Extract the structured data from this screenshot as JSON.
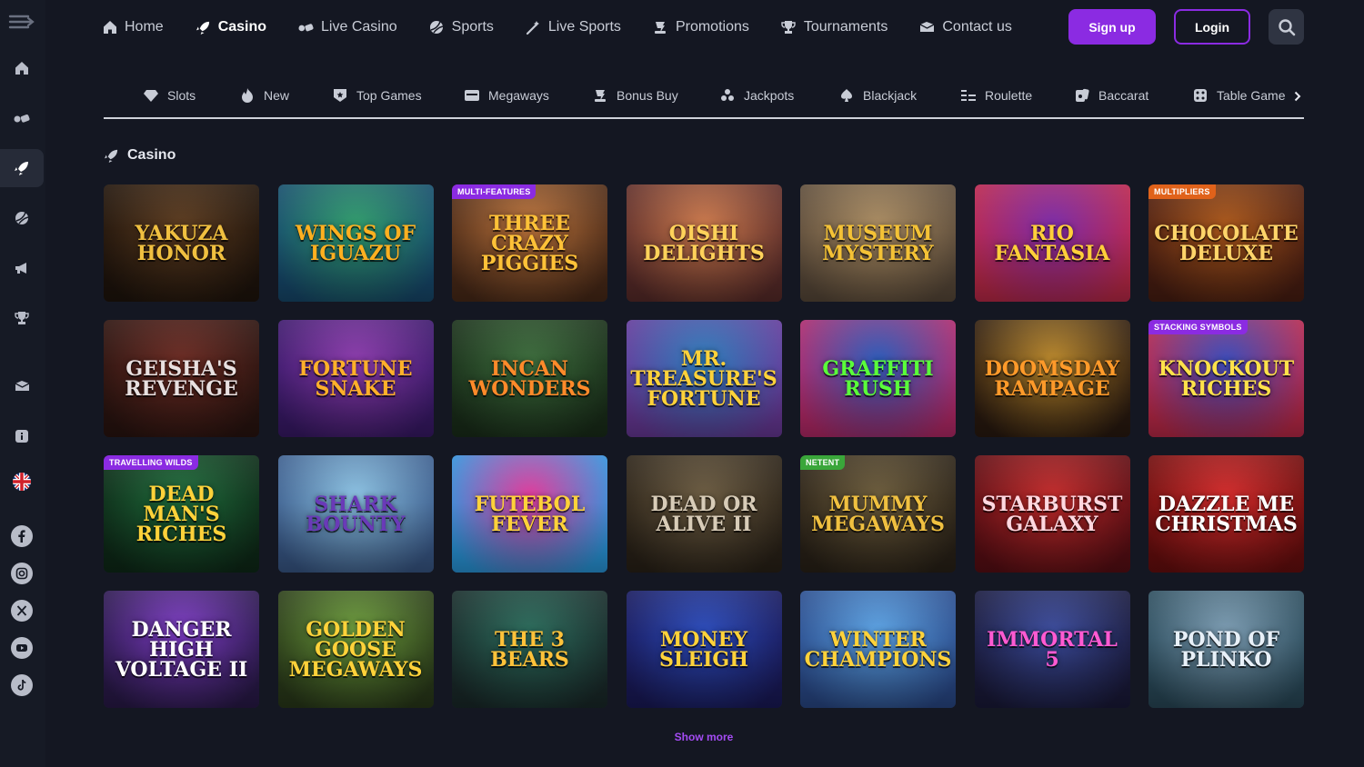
{
  "sidebar": {
    "items": [
      {
        "icon": "menu-toggle-icon",
        "active": false
      },
      {
        "icon": "home-icon",
        "active": false
      },
      {
        "icon": "live-casino-icon",
        "active": false
      },
      {
        "icon": "rocket-icon",
        "active": true
      },
      {
        "icon": "sports-ball-icon",
        "active": false
      },
      {
        "icon": "megaphone-icon",
        "active": false
      },
      {
        "icon": "trophy-icon",
        "active": false
      },
      {
        "icon": "mail-icon",
        "active": false
      },
      {
        "icon": "info-icon",
        "active": false
      },
      {
        "icon": "uk-flag-icon",
        "active": false
      },
      {
        "icon": "facebook-icon",
        "active": false
      },
      {
        "icon": "instagram-icon",
        "active": false
      },
      {
        "icon": "x-icon",
        "active": false
      },
      {
        "icon": "youtube-icon",
        "active": false
      },
      {
        "icon": "tiktok-icon",
        "active": false
      }
    ]
  },
  "nav": {
    "items": [
      {
        "label": "Home",
        "icon": "home-icon",
        "active": false
      },
      {
        "label": "Casino",
        "icon": "rocket-icon",
        "active": true
      },
      {
        "label": "Live Casino",
        "icon": "live-casino-icon",
        "active": false
      },
      {
        "label": "Sports",
        "icon": "sports-ball-icon",
        "active": false
      },
      {
        "label": "Live Sports",
        "icon": "live-sports-icon",
        "active": false
      },
      {
        "label": "Promotions",
        "icon": "promotions-icon",
        "active": false
      },
      {
        "label": "Tournaments",
        "icon": "trophy-icon",
        "active": false
      },
      {
        "label": "Contact us",
        "icon": "mail-icon",
        "active": false
      }
    ],
    "signup": "Sign up",
    "login": "Login"
  },
  "categories": [
    {
      "label": "Slots",
      "icon": "diamond-icon"
    },
    {
      "label": "New",
      "icon": "flame-icon"
    },
    {
      "label": "Top Games",
      "icon": "star-shield-icon"
    },
    {
      "label": "Megaways",
      "icon": "megaways-icon"
    },
    {
      "label": "Bonus Buy",
      "icon": "bonus-buy-icon"
    },
    {
      "label": "Jackpots",
      "icon": "jackpot-icon"
    },
    {
      "label": "Blackjack",
      "icon": "spade-icon"
    },
    {
      "label": "Roulette",
      "icon": "roulette-icon"
    },
    {
      "label": "Baccarat",
      "icon": "cards-icon"
    },
    {
      "label": "Table Games",
      "icon": "dice-icon"
    }
  ],
  "section": {
    "title": "Casino"
  },
  "games": [
    {
      "title": "Yakuza Honor",
      "badge": "",
      "bg1": "#5a3a1e",
      "bg2": "#1f140c",
      "color": "#f0c040"
    },
    {
      "title": "Wings of Iguazu",
      "badge": "",
      "bg1": "#2f9a6a",
      "bg2": "#174a6e",
      "color": "#ffb020"
    },
    {
      "title": "Three Crazy Piggies",
      "badge": "MULTI-FEATURES",
      "bg1": "#b8713a",
      "bg2": "#4a2a18",
      "color": "#ffc238"
    },
    {
      "title": "Oishi Delights",
      "badge": "",
      "bg1": "#c9774a",
      "bg2": "#5a2c2a",
      "color": "#ffd25a"
    },
    {
      "title": "Museum Mystery",
      "badge": "",
      "bg1": "#a88a60",
      "bg2": "#5a4a3a",
      "color": "#f4c236"
    },
    {
      "title": "Rio Fantasia",
      "badge": "",
      "bg1": "#7a2aa6",
      "bg2": "#c02a4a",
      "color": "#ffcf3a"
    },
    {
      "title": "Chocolate Deluxe",
      "badge": "MULTIPLIERS",
      "bg1": "#a8561a",
      "bg2": "#4a1e12",
      "color": "#ffd56a"
    },
    {
      "title": "Geisha's Revenge",
      "badge": "",
      "bg1": "#6a2a22",
      "bg2": "#2a1410",
      "color": "#e8e0e0"
    },
    {
      "title": "Fortune Snake",
      "badge": "",
      "bg1": "#8a3aaa",
      "bg2": "#3a1a6a",
      "color": "#ffb02a"
    },
    {
      "title": "Incan Wonders",
      "badge": "",
      "bg1": "#3a6a3a",
      "bg2": "#1a2e1a",
      "color": "#ff8a2a"
    },
    {
      "title": "Mr. Treasure's Fortune",
      "badge": "",
      "bg1": "#2a7ab8",
      "bg2": "#6a3a9a",
      "color": "#ffd23a"
    },
    {
      "title": "Graffiti Rush",
      "badge": "",
      "bg1": "#2a5ab8",
      "bg2": "#b82a6a",
      "color": "#5aff3a"
    },
    {
      "title": "Doomsday Rampage",
      "badge": "",
      "bg1": "#b8862a",
      "bg2": "#2a1a10",
      "color": "#ff9a2a"
    },
    {
      "title": "Knockout Riches",
      "badge": "STACKING SYMBOLS",
      "bg1": "#3a4ab8",
      "bg2": "#c02a4a",
      "color": "#ffe24a"
    },
    {
      "title": "Dead Man's Riches",
      "badge": "TRAVELLING WILDS",
      "bg1": "#1e6a3a",
      "bg2": "#0e2a18",
      "color": "#ffd23a"
    },
    {
      "title": "Shark Bounty",
      "badge": "",
      "bg1": "#8ac0e0",
      "bg2": "#3a5a8a",
      "color": "#6a3ab8"
    },
    {
      "title": "Futebol Fever",
      "badge": "",
      "bg1": "#e03a9a",
      "bg2": "#2a9ae0",
      "color": "#ffd23a"
    },
    {
      "title": "Dead or Alive II",
      "badge": "",
      "bg1": "#6a5a40",
      "bg2": "#2a2218",
      "color": "#d8ccb8"
    },
    {
      "title": "Mummy Megaways",
      "badge": "NETENT",
      "bg1": "#6a5a3a",
      "bg2": "#2a2218",
      "color": "#f0c040"
    },
    {
      "title": "Starburst Galaxy",
      "badge": "",
      "bg1": "#c02a2a",
      "bg2": "#5a0e14",
      "color": "#ffd8e0"
    },
    {
      "title": "Dazzle Me Christmas",
      "badge": "",
      "bg1": "#d02a2a",
      "bg2": "#6a0e0e",
      "color": "#ffffff"
    },
    {
      "title": "Danger High Voltage II",
      "badge": "",
      "bg1": "#7a3ac0",
      "bg2": "#2a1a4a",
      "color": "#ffffff"
    },
    {
      "title": "Golden Goose Megaways",
      "badge": "",
      "bg1": "#6a9a3a",
      "bg2": "#2a3a1a",
      "color": "#ffd23a"
    },
    {
      "title": "The 3 Bears",
      "badge": "",
      "bg1": "#2a6a5a",
      "bg2": "#1a2a2a",
      "color": "#ffc23a"
    },
    {
      "title": "Money Sleigh",
      "badge": "",
      "bg1": "#2a4ab8",
      "bg2": "#1a1a5a",
      "color": "#ffd23a"
    },
    {
      "title": "Winter Champions",
      "badge": "",
      "bg1": "#5aa0e0",
      "bg2": "#2a4a8a",
      "color": "#ffd23a"
    },
    {
      "title": "Immortal 5",
      "badge": "",
      "bg1": "#3a4a9a",
      "bg2": "#1a1a3a",
      "color": "#ff5ad2"
    },
    {
      "title": "Pond of Plinko",
      "badge": "",
      "bg1": "#7a9ab0",
      "bg2": "#2a4a5a",
      "color": "#e8f0f8"
    }
  ],
  "show_more": "Show more",
  "colors": {
    "accent": "#8b2be2",
    "background": "#141722",
    "sidebar": "#161a25"
  }
}
